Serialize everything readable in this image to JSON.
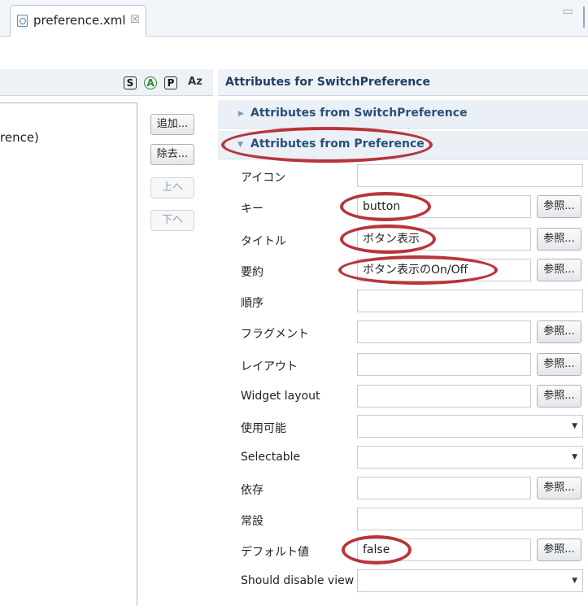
{
  "editor_tab": {
    "title": "preference.xml",
    "close_symbol": "☒"
  },
  "window": {
    "minimize_symbol": "▭"
  },
  "outline_toolbar": {
    "s": "S",
    "a": "A",
    "p": "P",
    "az": "Az"
  },
  "tree": {
    "item": "rence)"
  },
  "side_buttons": {
    "add": "追加...",
    "remove": "除去...",
    "up": "上へ",
    "down": "下へ"
  },
  "attributes": {
    "title": "Attributes for SwitchPreference",
    "section_switch": "Attributes from SwitchPreference",
    "section_pref": "Attributes from Preference",
    "ref_label": "参照...",
    "rows": [
      {
        "label": "アイコン",
        "value": ""
      },
      {
        "label": "キー",
        "value": "button"
      },
      {
        "label": "タイトル",
        "value": "ボタン表示"
      },
      {
        "label": "要約",
        "value": "ボタン表示のOn/Off"
      },
      {
        "label": "順序",
        "value": ""
      },
      {
        "label": "フラグメント",
        "value": ""
      },
      {
        "label": "レイアウト",
        "value": ""
      },
      {
        "label": "Widget layout",
        "value": ""
      },
      {
        "label": "使用可能",
        "value": ""
      },
      {
        "label": "Selectable",
        "value": ""
      },
      {
        "label": "依存",
        "value": ""
      },
      {
        "label": "常設",
        "value": ""
      },
      {
        "label": "デフォルト値",
        "value": "false"
      },
      {
        "label": "Should disable view",
        "value": ""
      }
    ]
  },
  "colors": {
    "annotation": "#b8353b",
    "section_title": "#29507a"
  }
}
